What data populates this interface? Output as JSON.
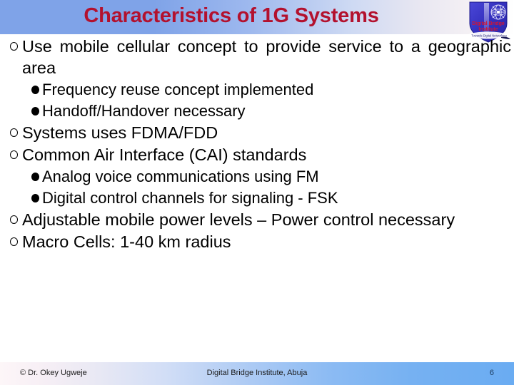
{
  "header": {
    "title": "Characteristics of 1G Systems",
    "logo": {
      "name": "digital-bridge-institute-logo",
      "line1": "Digital Bridge",
      "line2": "Institute",
      "ribbon": "Towards Digital Networking",
      "shield_color": "#3a3ac8",
      "text_color": "#c81028"
    },
    "gradient_from": "#7fa3e8",
    "gradient_to": "#ffffff",
    "title_color": "#b3112e"
  },
  "bullets": [
    {
      "level": 1,
      "marker": "open-circle",
      "text": "Use mobile cellular concept to provide service to a geographic area",
      "justified": true
    },
    {
      "level": 2,
      "marker": "filled-circle",
      "text": "Frequency reuse concept implemented",
      "justified": false
    },
    {
      "level": 2,
      "marker": "filled-circle",
      "text": "Handoff/Handover necessary",
      "justified": false
    },
    {
      "level": 1,
      "marker": "open-circle",
      "text": "Systems uses FDMA/FDD",
      "justified": false
    },
    {
      "level": 1,
      "marker": "open-circle",
      "text": "Common Air Interface (CAI) standards",
      "justified": false
    },
    {
      "level": 2,
      "marker": "filled-circle",
      "text": "Analog voice communications using FM",
      "justified": false
    },
    {
      "level": 2,
      "marker": "filled-circle",
      "text": "Digital control channels for signaling - FSK",
      "justified": false
    },
    {
      "level": 1,
      "marker": "open-circle",
      "text": "Adjustable mobile power levels – Power control necessary",
      "justified": false
    },
    {
      "level": 1,
      "marker": "open-circle",
      "text": "Macro Cells: 1-40 km radius",
      "justified": false
    }
  ],
  "footer": {
    "copyright": "© Dr. Okey Ugweje",
    "organization": "Digital Bridge Institute, Abuja",
    "page_number": "6",
    "gradient_from": "#fdf6f8",
    "gradient_to": "#6aacf2"
  }
}
